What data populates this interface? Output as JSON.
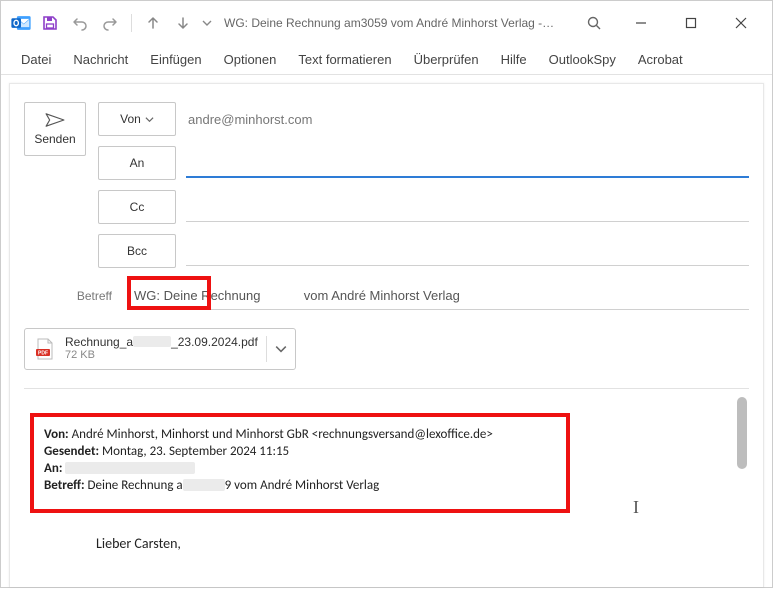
{
  "title": "WG: Deine Rechnung am3059 vom André Minhorst Verlag  -…",
  "menu": [
    "Datei",
    "Nachricht",
    "Einfügen",
    "Optionen",
    "Text formatieren",
    "Überprüfen",
    "Hilfe",
    "OutlookSpy",
    "Acrobat"
  ],
  "send_label": "Senden",
  "fields": {
    "from_btn": "Von",
    "from_value": "andre@minhorst.com",
    "to_btn": "An",
    "to_value": "",
    "cc_btn": "Cc",
    "cc_value": "",
    "bcc_btn": "Bcc",
    "bcc_value": ""
  },
  "subject_label": "Betreff",
  "subject_value": "WG: Deine Rechnung            vom André Minhorst Verlag",
  "attachment": {
    "name_prefix": "Rechnung_a",
    "name_suffix": "_23.09.2024.pdf",
    "size": "72 KB"
  },
  "quoted": {
    "from_label": "Von:",
    "from_value": "André Minhorst, Minhorst und Minhorst GbR <rechnungsversand@lexoffice.de>",
    "sent_label": "Gesendet:",
    "sent_value": "Montag, 23. September 2024 11:15",
    "to_label": "An:",
    "subject_label": "Betreff:",
    "subject_prefix": "Deine Rechnung a",
    "subject_suffix": "9 vom André Minhorst Verlag"
  },
  "greeting": "Lieber Carsten,"
}
